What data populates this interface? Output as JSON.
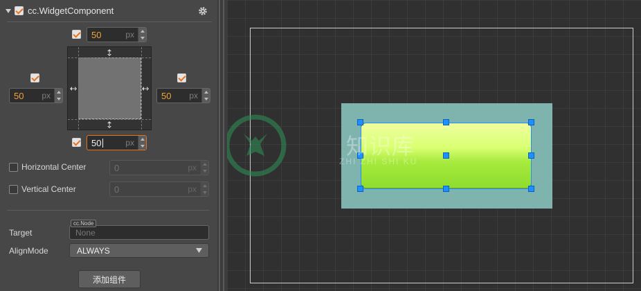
{
  "component": {
    "title": "cc.WidgetComponent",
    "icons": {
      "collapse": "triangle-down-icon",
      "settings": "gear-icon"
    }
  },
  "widget": {
    "top": {
      "checked": true,
      "value": "50",
      "unit": "px"
    },
    "left": {
      "checked": true,
      "value": "50",
      "unit": "px"
    },
    "right": {
      "checked": true,
      "value": "50",
      "unit": "px"
    },
    "bottom": {
      "checked": true,
      "value": "50",
      "unit": "px"
    }
  },
  "horizontal_center": {
    "label": "Horizontal Center",
    "checked": false,
    "value": "0",
    "unit": "px"
  },
  "vertical_center": {
    "label": "Vertical Center",
    "checked": false,
    "value": "0",
    "unit": "px"
  },
  "target": {
    "label": "Target",
    "type_tag": "cc.Node",
    "value": "None"
  },
  "align_mode": {
    "label": "AlignMode",
    "value": "ALWAYS"
  },
  "add_component_button": "添加组件",
  "watermark": {
    "title": "知识库",
    "subtitle": "ZHI ZHI SHI KU"
  },
  "colors": {
    "accent": "#e8721e",
    "handle": "#1e90ff",
    "button_green": "#9be23a"
  }
}
